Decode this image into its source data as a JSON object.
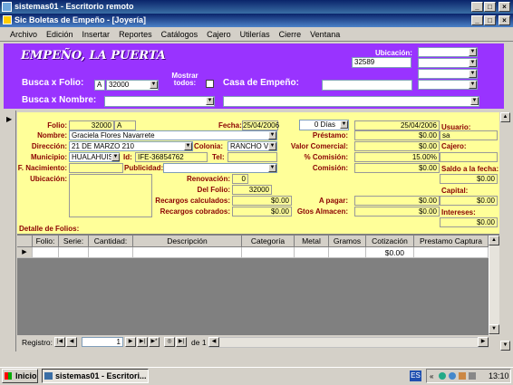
{
  "window": {
    "title": "sistemas01 - Escritorio remoto",
    "app_title": "Sic Boletas de Empeño - [Joyería]"
  },
  "menu": [
    "Archivo",
    "Edición",
    "Insertar",
    "Reportes",
    "Catálogos",
    "Cajero",
    "Utilerías",
    "Cierre",
    "Ventana"
  ],
  "header": {
    "brand": "EMPEÑO, LA PUERTA",
    "ubicacion_label": "Ubicación:",
    "ubicacion_value": "32589",
    "busca_folio_label": "Busca x Folio:",
    "folio_prefix": "A",
    "folio_value": "32000",
    "mostrar_todos_label": "Mostrar todos:",
    "casa_label": "Casa de Empeño:",
    "busca_nombre_label": "Busca x Nombre:"
  },
  "form": {
    "folio_label": "Folio:",
    "folio_num": "32000",
    "folio_letter": "A",
    "fecha_label": "Fecha:",
    "fecha_value": "25/04/2006",
    "dias_value": "0 Días",
    "fecha2_value": "25/04/2006",
    "usuario_label": "Usuario:",
    "nombre_label": "Nombre:",
    "nombre_value": "Graciela Flores Navarrete",
    "prestamo_label": "Préstamo:",
    "prestamo_value": "$0.00",
    "usuario_value": "sa",
    "direccion_label": "Dirección:",
    "direccion_value": "21 DE MARZO 210",
    "colonia_label": "Colonia:",
    "colonia_value": "RANCHO V",
    "valor_label": "Valor Comercial:",
    "valor_value": "$0.00",
    "cajero_label": "Cajero:",
    "municipio_label": "Municipio:",
    "municipio_value": "HUALAHUISI",
    "id_label": "Id:",
    "id_value": "IFE-36854762",
    "tel_label": "Tel:",
    "comision_pct_label": "% Comisión:",
    "comision_pct_value": "15.00%",
    "fnac_label": "F. Nacimiento:",
    "publicidad_label": "Publicidad:",
    "comision_label": "Comisión:",
    "comision_value": "$0.00",
    "saldo_label": "Saldo a la fecha:",
    "saldo_value": "$0.00",
    "ubicacion_label": "Ubicación:",
    "renovacion_label": "Renovación:",
    "renovacion_value": "0",
    "delfolio_label": "Del Folio:",
    "delfolio_value": "32000",
    "capital_label": "Capital:",
    "recargos_calc_label": "Recargos calculados:",
    "recargos_calc_value": "$0.00",
    "apagar_label": "A pagar:",
    "apagar_value": "$0.00",
    "capital_value": "$0.00",
    "recargos_cob_label": "Recargos cobrados:",
    "recargos_cob_value": "$0.00",
    "gtos_label": "Gtos Almacen:",
    "gtos_value": "$0.00",
    "intereses_label": "Intereses:",
    "intereses_value": "$0.00",
    "detalle_label": "Detalle de Folios:"
  },
  "grid": {
    "columns": [
      "Folio:",
      "Serie:",
      "Cantidad:",
      "Descripción",
      "Categoría",
      "Metal",
      "Gramos",
      "Cotización",
      "Prestamo Captura"
    ],
    "cotizacion_value": "$0.00"
  },
  "nav": {
    "label": "Registro:",
    "current": "1",
    "of_text": "de 1"
  },
  "taskbar": {
    "start": "Inicio",
    "task": "sistemas01 - Escritori...",
    "lang": "ES",
    "clock": "13:10"
  },
  "colors": {
    "header_bg": "#9933ff",
    "form_bg": "#ffff99",
    "label_color": "#8b0000"
  }
}
